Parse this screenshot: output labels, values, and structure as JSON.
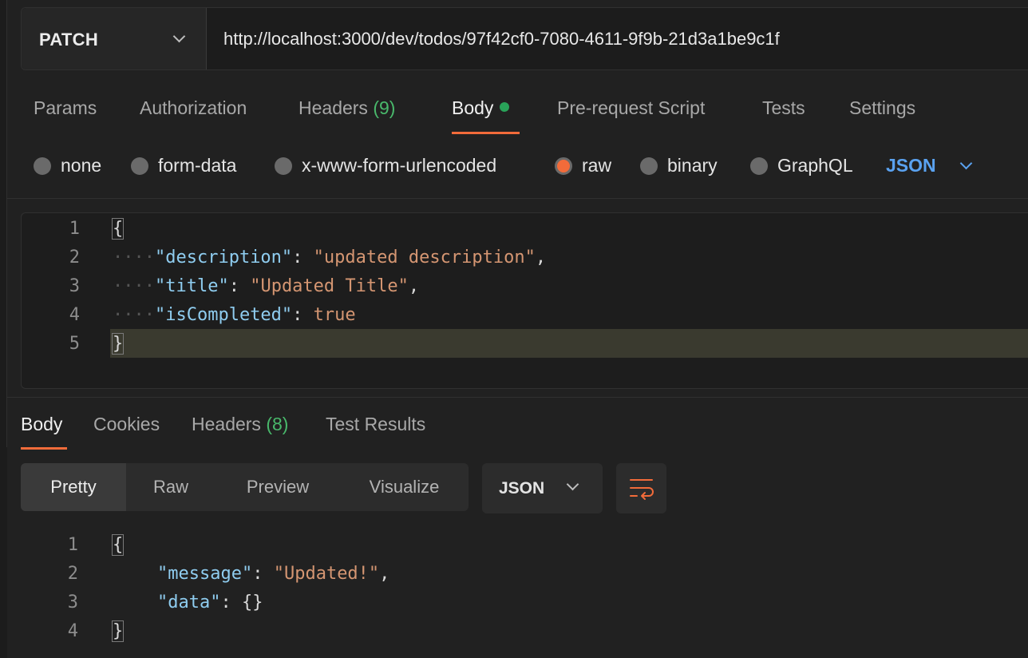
{
  "request": {
    "method": "PATCH",
    "url": "http://localhost:3000/dev/todos/97f42cf0-7080-4611-9f9b-21d3a1be9c1f"
  },
  "request_tabs": [
    {
      "label": "Params"
    },
    {
      "label": "Authorization"
    },
    {
      "label": "Headers",
      "count": "(9)"
    },
    {
      "label": "Body",
      "active": true
    },
    {
      "label": "Pre-request Script"
    },
    {
      "label": "Tests"
    },
    {
      "label": "Settings"
    }
  ],
  "body_types": [
    {
      "label": "none"
    },
    {
      "label": "form-data"
    },
    {
      "label": "x-www-form-urlencoded"
    },
    {
      "label": "raw",
      "selected": true
    },
    {
      "label": "binary"
    },
    {
      "label": "GraphQL"
    }
  ],
  "body_format": "JSON",
  "request_body": {
    "line_numbers": [
      "1",
      "2",
      "3",
      "4",
      "5"
    ],
    "open_brace": "{",
    "close_brace": "}",
    "desc_key": "\"description\"",
    "desc_val": "\"updated description\"",
    "title_key": "\"title\"",
    "title_val": "\"Updated Title\"",
    "completed_key": "\"isCompleted\"",
    "completed_val": "true"
  },
  "response_tabs": [
    {
      "label": "Body",
      "active": true
    },
    {
      "label": "Cookies"
    },
    {
      "label": "Headers",
      "count": "(8)"
    },
    {
      "label": "Test Results"
    }
  ],
  "view_modes": [
    "Pretty",
    "Raw",
    "Preview",
    "Visualize"
  ],
  "response_format": "JSON",
  "response_body": {
    "line_numbers": [
      "1",
      "2",
      "3",
      "4"
    ],
    "open_brace": "{",
    "close_brace": "}",
    "msg_key": "\"message\"",
    "msg_val": "\"Updated!\"",
    "data_key": "\"data\"",
    "data_val": "{}"
  },
  "colors": {
    "accent": "#f26b3a",
    "count_green": "#49b86b",
    "link_blue": "#5aa2f0",
    "json_key": "#8fcdf0",
    "json_value": "#d59672"
  },
  "icons": [
    "chevron-down-icon",
    "status-dot-icon",
    "wrap-lines-icon"
  ]
}
